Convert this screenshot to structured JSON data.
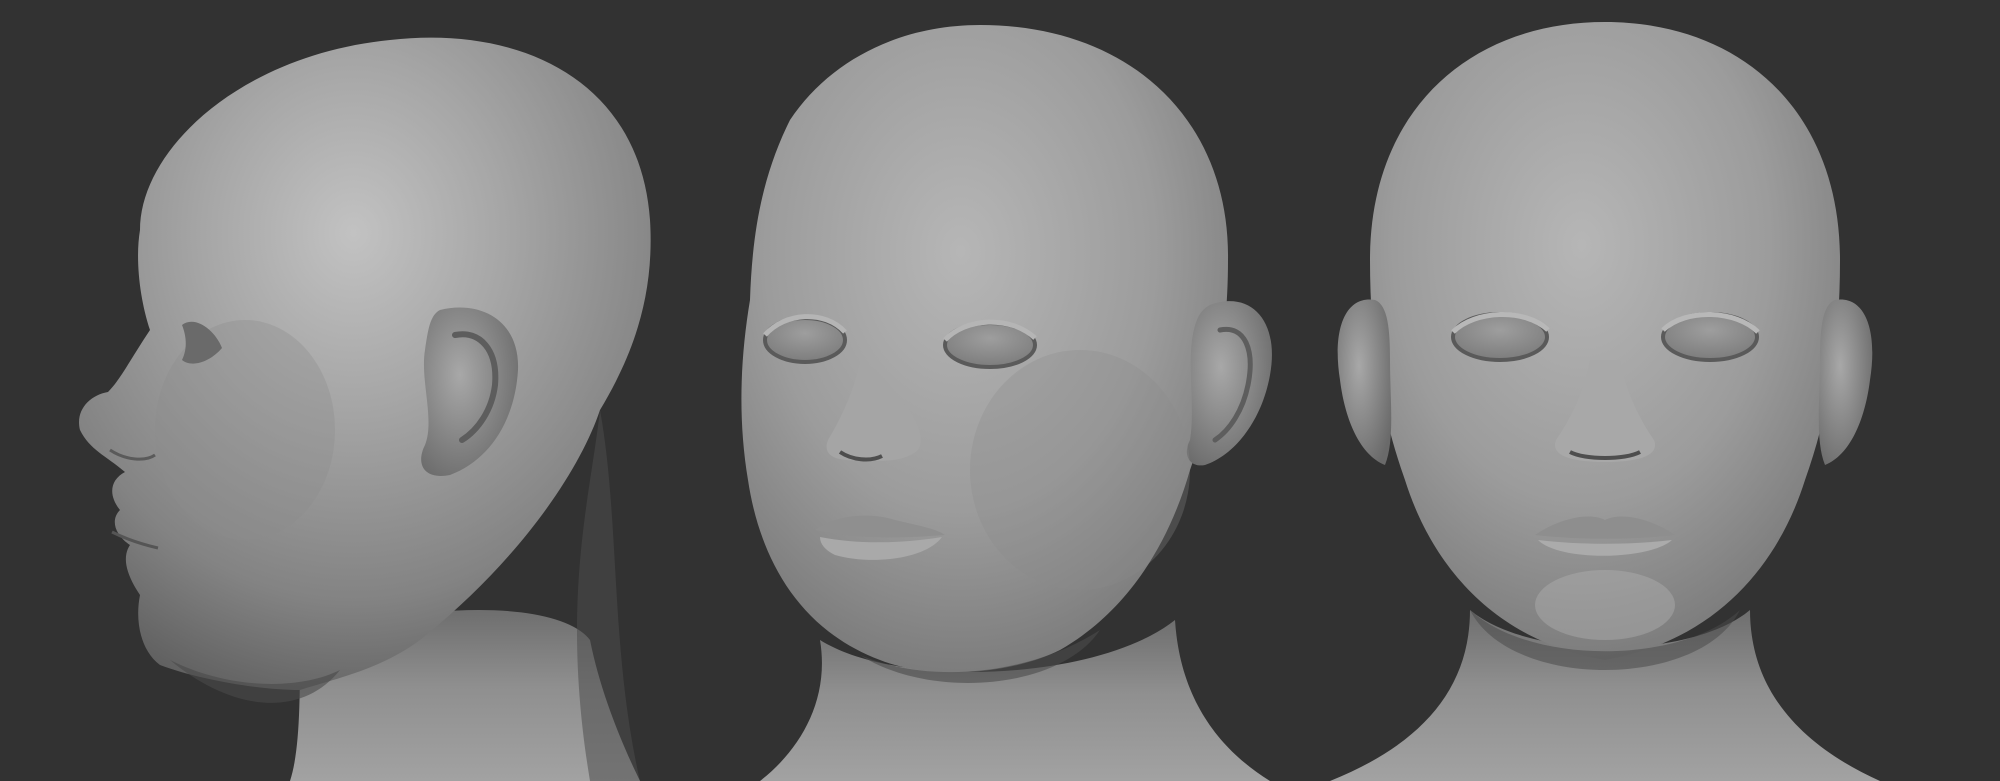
{
  "scene": {
    "background_color": "#323232",
    "clay_color": "#9a9a9a",
    "views": [
      {
        "name": "side-profile",
        "facing": "left"
      },
      {
        "name": "three-quarter",
        "facing": "front-left"
      },
      {
        "name": "front",
        "facing": "front"
      }
    ]
  }
}
